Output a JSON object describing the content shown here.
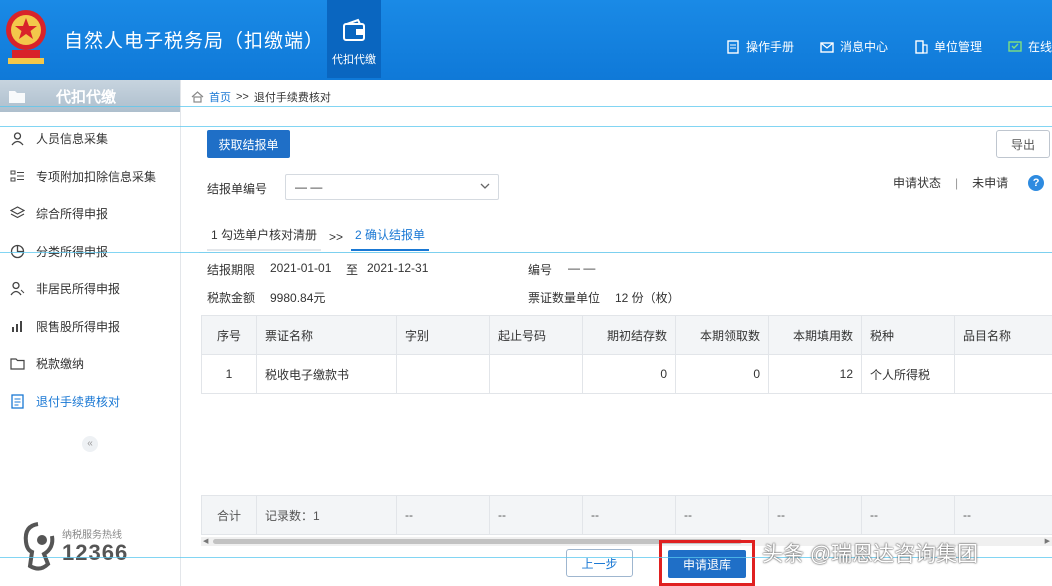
{
  "header": {
    "app_title": "自然人电子税务局（扣缴端）",
    "tool_tile_label": "代扣代缴",
    "links": [
      {
        "label": "操作手册",
        "icon": "manual-icon"
      },
      {
        "label": "消息中心",
        "icon": "mail-icon"
      },
      {
        "label": "单位管理",
        "icon": "building-icon"
      },
      {
        "label": "在线",
        "icon": "online-icon"
      }
    ]
  },
  "sidebar": {
    "title": "代扣代缴",
    "items": [
      {
        "label": "人员信息采集",
        "icon": "person-icon"
      },
      {
        "label": "专项附加扣除信息采集",
        "icon": "list-icon"
      },
      {
        "label": "综合所得申报",
        "icon": "layers-icon"
      },
      {
        "label": "分类所得申报",
        "icon": "pie-icon"
      },
      {
        "label": "非居民所得申报",
        "icon": "person-outline-icon"
      },
      {
        "label": "限售股所得申报",
        "icon": "bar-chart-icon"
      },
      {
        "label": "税款缴纳",
        "icon": "folder-icon"
      },
      {
        "label": "退付手续费核对",
        "icon": "document-icon"
      }
    ],
    "active_index": 7,
    "collapse_glyph": "«",
    "hotline_label": "纳税服务热线",
    "hotline_number": "12366"
  },
  "breadcrumb": {
    "home": "首页",
    "separator": ">>",
    "current": "退付手续费核对"
  },
  "actions": {
    "fetch_label": "获取结报单",
    "export_label": "导出",
    "prev_label": "上一步",
    "apply_label": "申请退库"
  },
  "form": {
    "statement_no_label": "结报单编号",
    "statement_no_value": "— —",
    "status_label": "申请状态",
    "status_separator": "|",
    "status_value": "未申请",
    "help_glyph": "?"
  },
  "steps": [
    {
      "label": "1 勾选单户核对清册"
    },
    {
      "label": "2 确认结报单"
    }
  ],
  "steps_separator": ">>",
  "active_step": 1,
  "summary": {
    "period_label": "结报期限",
    "period_start": "2021-01-01",
    "period_to": "至",
    "period_end": "2021-12-31",
    "number_label": "编号",
    "number_value": "— —",
    "amount_label": "税款金额",
    "amount_value": "9980.84元",
    "ticket_label": "票证数量单位",
    "ticket_value": "12 份（枚）"
  },
  "table": {
    "columns": [
      "序号",
      "票证名称",
      "字别",
      "起止号码",
      "期初结存数",
      "本期领取数",
      "本期填用数",
      "税种",
      "品目名称"
    ],
    "rows": [
      [
        "1",
        "税收电子缴款书",
        "",
        "",
        "0",
        "0",
        "12",
        "个人所得税",
        ""
      ]
    ],
    "footer": [
      "合计",
      "记录数：1",
      "--",
      "--",
      "--",
      "--",
      "--",
      "--",
      "--"
    ]
  },
  "scroll_position": 0.64,
  "watermark": "头条 @瑞恩达咨询集团",
  "colors": {
    "topbar": "#1584e0",
    "primary_button": "#1f6fc7",
    "link": "#1a78d4",
    "highlight_box": "#e02020"
  }
}
